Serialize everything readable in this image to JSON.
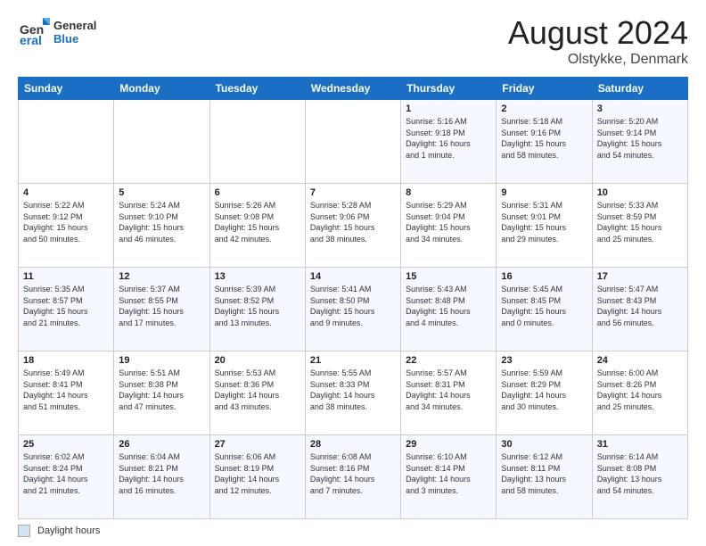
{
  "header": {
    "logo_line1": "General",
    "logo_line2": "Blue",
    "month_year": "August 2024",
    "location": "Olstykke, Denmark"
  },
  "days_of_week": [
    "Sunday",
    "Monday",
    "Tuesday",
    "Wednesday",
    "Thursday",
    "Friday",
    "Saturday"
  ],
  "footer_label": "Daylight hours",
  "weeks": [
    [
      {
        "day": "",
        "info": ""
      },
      {
        "day": "",
        "info": ""
      },
      {
        "day": "",
        "info": ""
      },
      {
        "day": "",
        "info": ""
      },
      {
        "day": "1",
        "info": "Sunrise: 5:16 AM\nSunset: 9:18 PM\nDaylight: 16 hours\nand 1 minute."
      },
      {
        "day": "2",
        "info": "Sunrise: 5:18 AM\nSunset: 9:16 PM\nDaylight: 15 hours\nand 58 minutes."
      },
      {
        "day": "3",
        "info": "Sunrise: 5:20 AM\nSunset: 9:14 PM\nDaylight: 15 hours\nand 54 minutes."
      }
    ],
    [
      {
        "day": "4",
        "info": "Sunrise: 5:22 AM\nSunset: 9:12 PM\nDaylight: 15 hours\nand 50 minutes."
      },
      {
        "day": "5",
        "info": "Sunrise: 5:24 AM\nSunset: 9:10 PM\nDaylight: 15 hours\nand 46 minutes."
      },
      {
        "day": "6",
        "info": "Sunrise: 5:26 AM\nSunset: 9:08 PM\nDaylight: 15 hours\nand 42 minutes."
      },
      {
        "day": "7",
        "info": "Sunrise: 5:28 AM\nSunset: 9:06 PM\nDaylight: 15 hours\nand 38 minutes."
      },
      {
        "day": "8",
        "info": "Sunrise: 5:29 AM\nSunset: 9:04 PM\nDaylight: 15 hours\nand 34 minutes."
      },
      {
        "day": "9",
        "info": "Sunrise: 5:31 AM\nSunset: 9:01 PM\nDaylight: 15 hours\nand 29 minutes."
      },
      {
        "day": "10",
        "info": "Sunrise: 5:33 AM\nSunset: 8:59 PM\nDaylight: 15 hours\nand 25 minutes."
      }
    ],
    [
      {
        "day": "11",
        "info": "Sunrise: 5:35 AM\nSunset: 8:57 PM\nDaylight: 15 hours\nand 21 minutes."
      },
      {
        "day": "12",
        "info": "Sunrise: 5:37 AM\nSunset: 8:55 PM\nDaylight: 15 hours\nand 17 minutes."
      },
      {
        "day": "13",
        "info": "Sunrise: 5:39 AM\nSunset: 8:52 PM\nDaylight: 15 hours\nand 13 minutes."
      },
      {
        "day": "14",
        "info": "Sunrise: 5:41 AM\nSunset: 8:50 PM\nDaylight: 15 hours\nand 9 minutes."
      },
      {
        "day": "15",
        "info": "Sunrise: 5:43 AM\nSunset: 8:48 PM\nDaylight: 15 hours\nand 4 minutes."
      },
      {
        "day": "16",
        "info": "Sunrise: 5:45 AM\nSunset: 8:45 PM\nDaylight: 15 hours\nand 0 minutes."
      },
      {
        "day": "17",
        "info": "Sunrise: 5:47 AM\nSunset: 8:43 PM\nDaylight: 14 hours\nand 56 minutes."
      }
    ],
    [
      {
        "day": "18",
        "info": "Sunrise: 5:49 AM\nSunset: 8:41 PM\nDaylight: 14 hours\nand 51 minutes."
      },
      {
        "day": "19",
        "info": "Sunrise: 5:51 AM\nSunset: 8:38 PM\nDaylight: 14 hours\nand 47 minutes."
      },
      {
        "day": "20",
        "info": "Sunrise: 5:53 AM\nSunset: 8:36 PM\nDaylight: 14 hours\nand 43 minutes."
      },
      {
        "day": "21",
        "info": "Sunrise: 5:55 AM\nSunset: 8:33 PM\nDaylight: 14 hours\nand 38 minutes."
      },
      {
        "day": "22",
        "info": "Sunrise: 5:57 AM\nSunset: 8:31 PM\nDaylight: 14 hours\nand 34 minutes."
      },
      {
        "day": "23",
        "info": "Sunrise: 5:59 AM\nSunset: 8:29 PM\nDaylight: 14 hours\nand 30 minutes."
      },
      {
        "day": "24",
        "info": "Sunrise: 6:00 AM\nSunset: 8:26 PM\nDaylight: 14 hours\nand 25 minutes."
      }
    ],
    [
      {
        "day": "25",
        "info": "Sunrise: 6:02 AM\nSunset: 8:24 PM\nDaylight: 14 hours\nand 21 minutes."
      },
      {
        "day": "26",
        "info": "Sunrise: 6:04 AM\nSunset: 8:21 PM\nDaylight: 14 hours\nand 16 minutes."
      },
      {
        "day": "27",
        "info": "Sunrise: 6:06 AM\nSunset: 8:19 PM\nDaylight: 14 hours\nand 12 minutes."
      },
      {
        "day": "28",
        "info": "Sunrise: 6:08 AM\nSunset: 8:16 PM\nDaylight: 14 hours\nand 7 minutes."
      },
      {
        "day": "29",
        "info": "Sunrise: 6:10 AM\nSunset: 8:14 PM\nDaylight: 14 hours\nand 3 minutes."
      },
      {
        "day": "30",
        "info": "Sunrise: 6:12 AM\nSunset: 8:11 PM\nDaylight: 13 hours\nand 58 minutes."
      },
      {
        "day": "31",
        "info": "Sunrise: 6:14 AM\nSunset: 8:08 PM\nDaylight: 13 hours\nand 54 minutes."
      }
    ]
  ]
}
